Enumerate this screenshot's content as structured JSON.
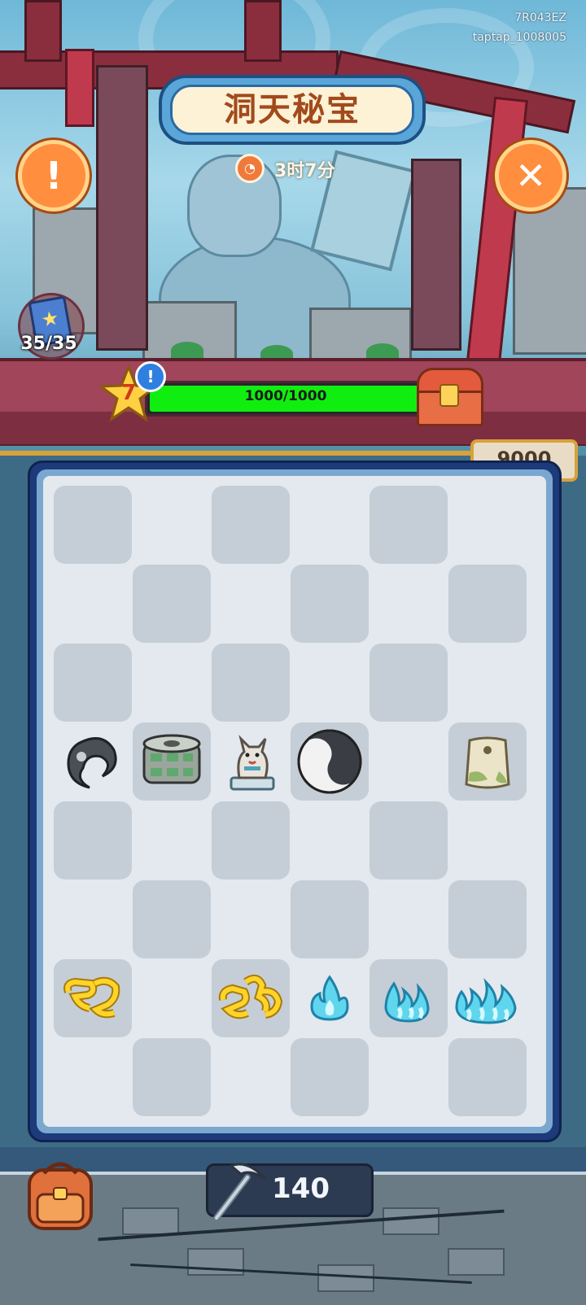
{
  "header": {
    "title": "洞天秘宝",
    "timer": "3时7分",
    "device_code": "7R043EZ",
    "user_id": "taptap_1008005"
  },
  "buttons": {
    "info_glyph": "!",
    "close_glyph": "✕"
  },
  "collection": {
    "count": "35/35"
  },
  "progress": {
    "level": "7",
    "alert_glyph": "!",
    "value_text": "1000/1000",
    "fill_fraction": 1.0
  },
  "score": "9000",
  "pickaxe": {
    "count": "140"
  },
  "board": {
    "rows": 8,
    "cols": 6,
    "items": [
      {
        "row": 3,
        "col": 0,
        "icon": "dark-yin-yang-half-icon"
      },
      {
        "row": 3,
        "col": 1,
        "icon": "jade-cong-cylinder-icon"
      },
      {
        "row": 3,
        "col": 2,
        "icon": "dog-statue-icon"
      },
      {
        "row": 3,
        "col": 3,
        "icon": "yin-yang-icon"
      },
      {
        "row": 3,
        "col": 5,
        "icon": "jade-bi-disc-icon"
      },
      {
        "row": 6,
        "col": 0,
        "icon": "gold-chain-small-icon"
      },
      {
        "row": 6,
        "col": 2,
        "icon": "gold-chain-large-icon"
      },
      {
        "row": 6,
        "col": 3,
        "icon": "blue-flame-small-icon"
      },
      {
        "row": 6,
        "col": 4,
        "icon": "blue-flame-medium-icon"
      },
      {
        "row": 6,
        "col": 5,
        "icon": "blue-flame-large-icon"
      }
    ]
  },
  "colors": {
    "accent_orange": "#ff8e3e",
    "progress_green": "#10ee10",
    "board_frame": "#1d3a7a",
    "title_text": "#a24a1c"
  }
}
